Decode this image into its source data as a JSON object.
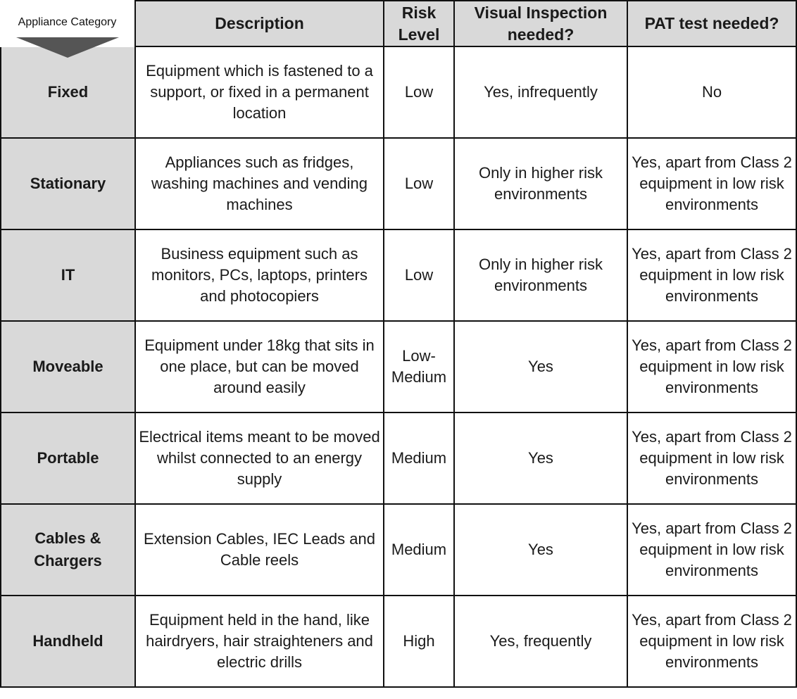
{
  "corner": {
    "label": "Appliance Category",
    "icon": "down-arrow-icon"
  },
  "headers": [
    "Description",
    "Risk Level",
    "Visual Inspection needed?",
    "PAT test needed?"
  ],
  "rows": [
    {
      "category": "Fixed",
      "description": "Equipment which is fastened to a support, or fixed in a permanent location",
      "risk": "Low",
      "visual": "Yes, infrequently",
      "pat": "No"
    },
    {
      "category": "Stationary",
      "description": "Appliances such as fridges, washing machines and vending machines",
      "risk": "Low",
      "visual": "Only in higher risk environments",
      "pat": "Yes, apart from Class 2 equipment in low risk environments"
    },
    {
      "category": "IT",
      "description": "Business equipment such as monitors, PCs, laptops, printers and photocopiers",
      "risk": "Low",
      "visual": "Only in higher risk environments",
      "pat": "Yes, apart from Class 2 equipment in low risk environments"
    },
    {
      "category": "Moveable",
      "description": "Equipment under 18kg that sits in one place, but can be moved around easily",
      "risk": "Low-Medium",
      "visual": "Yes",
      "pat": "Yes, apart from Class 2 equipment in low risk environments"
    },
    {
      "category": "Portable",
      "description": "Electrical items meant to be moved whilst connected to an energy supply",
      "risk": "Medium",
      "visual": "Yes",
      "pat": "Yes, apart from Class 2 equipment in low risk environments"
    },
    {
      "category": "Cables & Chargers",
      "description": "Extension Cables, IEC Leads and Cable reels",
      "risk": "Medium",
      "visual": "Yes",
      "pat": "Yes, apart from Class 2 equipment in low risk environments"
    },
    {
      "category": "Handheld",
      "description": "Equipment held in the hand, like hairdryers, hair straighteners and electric drills",
      "risk": "High",
      "visual": "Yes, frequently",
      "pat": "Yes, apart from Class 2 equipment in low risk environments"
    }
  ]
}
